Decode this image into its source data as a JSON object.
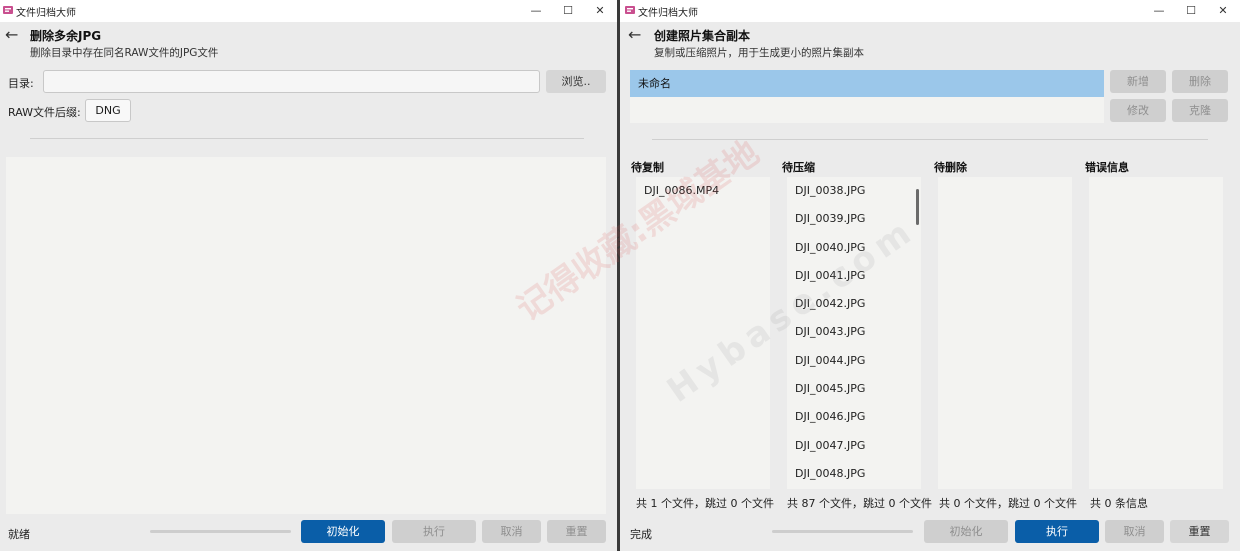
{
  "left": {
    "app_title": "文件归档大师",
    "page_title": "删除多余JPG",
    "page_subtitle": "删除目录中存在同名RAW文件的JPG文件",
    "dir_label": "目录:",
    "dir_value": "",
    "browse_label": "浏览..",
    "raw_label": "RAW文件后缀:",
    "raw_value": "DNG",
    "status": "就绪",
    "buttons": {
      "init": "初始化",
      "execute": "执行",
      "cancel": "取消",
      "reset": "重置"
    }
  },
  "right": {
    "app_title": "文件归档大师",
    "page_title": "创建照片集合副本",
    "page_subtitle": "复制或压缩照片，用于生成更小的照片集副本",
    "selected_item": "未命名",
    "side_buttons": {
      "add": "新增",
      "delete": "删除",
      "edit": "修改",
      "clone": "克隆"
    },
    "columns": [
      {
        "header": "待复制",
        "items": [
          "DJI_0086.MP4"
        ],
        "footer": "共 1 个文件，跳过 0 个文件"
      },
      {
        "header": "待压缩",
        "items": [
          "DJI_0038.JPG",
          "DJI_0039.JPG",
          "DJI_0040.JPG",
          "DJI_0041.JPG",
          "DJI_0042.JPG",
          "DJI_0043.JPG",
          "DJI_0044.JPG",
          "DJI_0045.JPG",
          "DJI_0046.JPG",
          "DJI_0047.JPG",
          "DJI_0048.JPG"
        ],
        "footer": "共 87 个文件，跳过 0 个文件"
      },
      {
        "header": "待删除",
        "items": [],
        "footer": "共 0 个文件，跳过 0 个文件"
      },
      {
        "header": "错误信息",
        "items": [],
        "footer": "共 0 条信息"
      }
    ],
    "status": "完成",
    "buttons": {
      "init": "初始化",
      "execute": "执行",
      "cancel": "取消",
      "reset": "重置"
    }
  },
  "window_controls": {
    "minimize": "—",
    "maximize": "☐",
    "close": "✕"
  },
  "watermark": {
    "text": "记得收藏:黑域基地",
    "brand": "Hybase.com"
  },
  "icons": {
    "back": "left-arrow-icon",
    "app": "app-logo-icon"
  },
  "colors": {
    "primary": "#0a5ea8",
    "selection": "#9bc7ea",
    "window_bg": "#ebebeb",
    "panel_bg": "#f3f3f1"
  }
}
